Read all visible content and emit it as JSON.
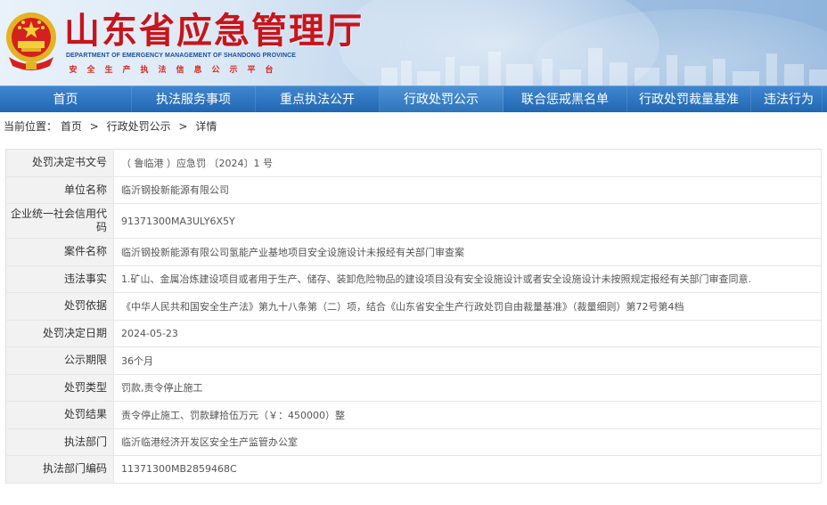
{
  "header": {
    "site_title": "山东省应急管理厅",
    "site_en": "DEPARTMENT OF EMERGENCY MANAGEMENT OF SHANDONG PROVINCE",
    "subtitle_chars": [
      "安",
      "全",
      "生",
      "产",
      "执",
      "法",
      "信",
      "息",
      "公",
      "示",
      "平",
      "台"
    ]
  },
  "nav": {
    "items": [
      {
        "label": "首页"
      },
      {
        "label": "执法服务事项"
      },
      {
        "label": "重点执法公开"
      },
      {
        "label": "行政处罚公示"
      },
      {
        "label": "联合惩戒黑名单"
      },
      {
        "label": "行政处罚裁量基准"
      },
      {
        "label": "违法行为"
      }
    ],
    "active_index": 3
  },
  "breadcrumb": {
    "prefix": "当前位置：",
    "items": [
      "首页",
      "行政处罚公示",
      "详情"
    ],
    "separator": ">"
  },
  "detail": {
    "rows": [
      {
        "label": "处罚决定书文号",
        "value": "（ 鲁临港 ）应急罚 〔2024〕1 号"
      },
      {
        "label": "单位名称",
        "value": "临沂钢投新能源有限公司"
      },
      {
        "label": "企业统一社会信用代码",
        "value": "91371300MA3ULY6X5Y"
      },
      {
        "label": "案件名称",
        "value": "临沂钢投新能源有限公司氢能产业基地项目安全设施设计未报经有关部门审查案"
      },
      {
        "label": "违法事实",
        "value": "1.矿山、金属冶炼建设项目或者用于生产、储存、装卸危险物品的建设项目没有安全设施设计或者安全设施设计未按照规定报经有关部门审查同意."
      },
      {
        "label": "处罚依据",
        "value": "《中华人民共和国安全生产法》第九十八条第（二）项，结合《山东省安全生产行政处罚自由裁量基准》（裁量细则）第72号第4档"
      },
      {
        "label": "处罚决定日期",
        "value": "2024-05-23"
      },
      {
        "label": "公示期限",
        "value": "36个月"
      },
      {
        "label": "处罚类型",
        "value": "罚款,责令停止施工"
      },
      {
        "label": "处罚结果",
        "value": "责令停止施工、罚款肆拾伍万元（￥：450000）整"
      },
      {
        "label": "执法部门",
        "value": "临沂临港经济开发区安全生产监管办公室"
      },
      {
        "label": "执法部门编码",
        "value": "11371300MB2859468C"
      }
    ]
  },
  "colors": {
    "title_red": "#c8141c",
    "nav_blue": "#2167b3",
    "label_bg": "#f2f2f2"
  }
}
